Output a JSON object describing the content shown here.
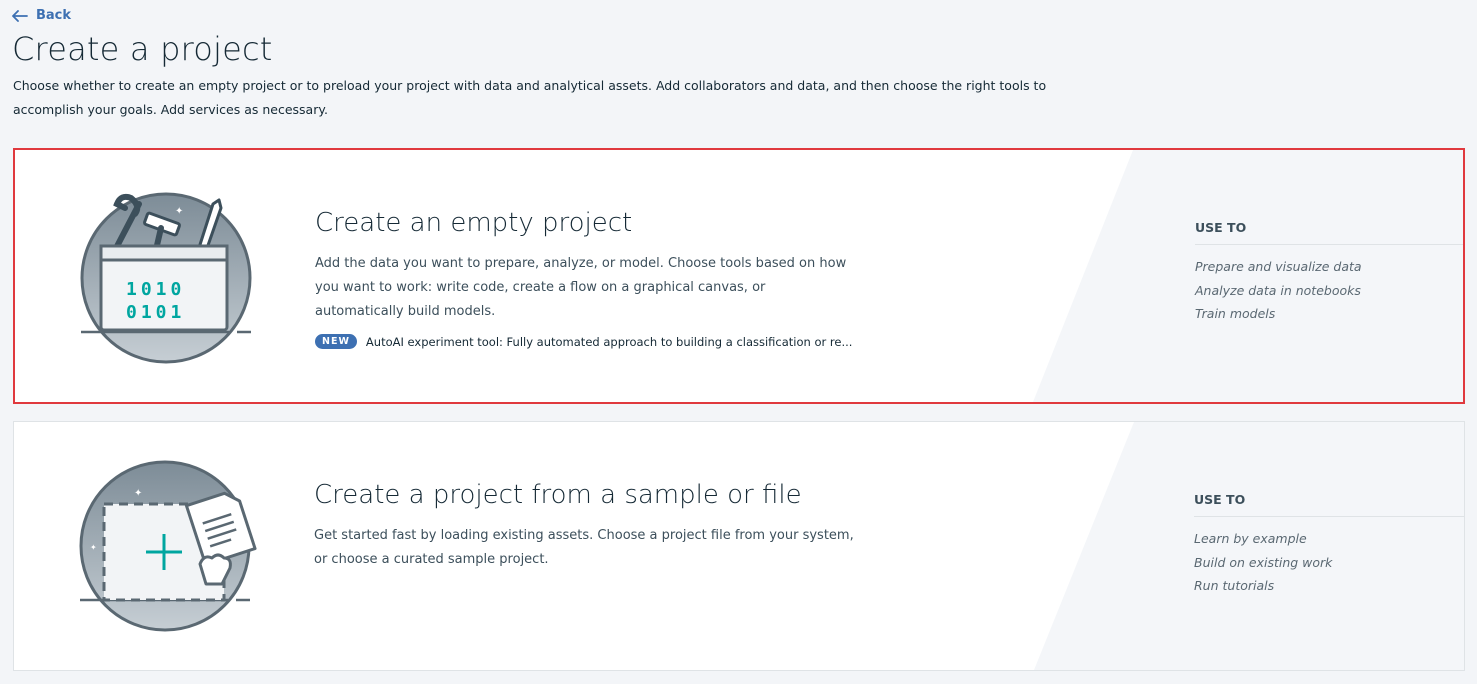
{
  "nav": {
    "back_label": "Back"
  },
  "page": {
    "title": "Create a project",
    "description": "Choose whether to create an empty project or to preload your project with data and analytical assets. Add collaborators and data, and then choose the right tools to accomplish your goals. Add services as necessary."
  },
  "cards": [
    {
      "title": "Create an empty project",
      "description": "Add the data you want to prepare, analyze, or model. Choose tools based on how you want to work: write code, create a flow on a graphical canvas, or automatically build models.",
      "badge": "NEW",
      "badge_text": "AutoAI experiment tool: Fully automated approach to building a classification or re...",
      "illustration_text": [
        "1010",
        "0101"
      ],
      "use_to_title": "USE TO",
      "use_to_items": [
        "Prepare and visualize data",
        "Analyze data in notebooks",
        "Train models"
      ],
      "selected": true
    },
    {
      "title": "Create a project from a sample or file",
      "description": "Get started fast by loading existing assets. Choose a project file from your system, or choose a curated sample project.",
      "use_to_title": "USE TO",
      "use_to_items": [
        "Learn by example",
        "Build on existing work",
        "Run tutorials"
      ],
      "selected": false
    }
  ],
  "colors": {
    "accent": "#3d70b2",
    "selection_border": "#e0393e",
    "teal": "#00a6a0",
    "illustration_fill": "#8c9ba5"
  },
  "icons": [
    "arrow-left-icon",
    "tools-toolbox-icon",
    "file-drop-icon"
  ]
}
